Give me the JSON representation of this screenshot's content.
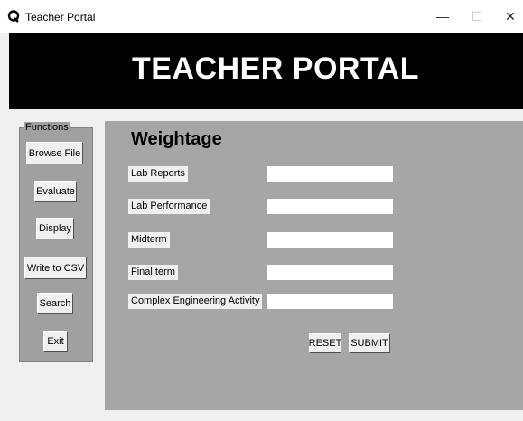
{
  "window": {
    "title": "Teacher Portal",
    "controls": {
      "minimize": "—",
      "maximize": "☐",
      "close": "✕"
    },
    "icon": "app-icon"
  },
  "header": {
    "title": "TEACHER PORTAL"
  },
  "functions": {
    "legend": "Functions",
    "buttons": [
      "Browse File",
      "Evaluate",
      "Display",
      "Write to CSV",
      "Search",
      "Exit"
    ]
  },
  "weightage": {
    "heading": "Weightage",
    "fields": [
      {
        "label": "Lab Reports",
        "value": ""
      },
      {
        "label": "Lab Performance",
        "value": ""
      },
      {
        "label": "Midterm",
        "value": ""
      },
      {
        "label": "Final term",
        "value": ""
      },
      {
        "label": "Complex Engineering Activity",
        "value": ""
      }
    ],
    "reset_label": "RESET",
    "submit_label": "SUBMIT"
  },
  "colors": {
    "banner": "#000000",
    "sidebar": "#a0a0a0",
    "panel": "#a6a6a6",
    "window": "#f0f0f0"
  }
}
